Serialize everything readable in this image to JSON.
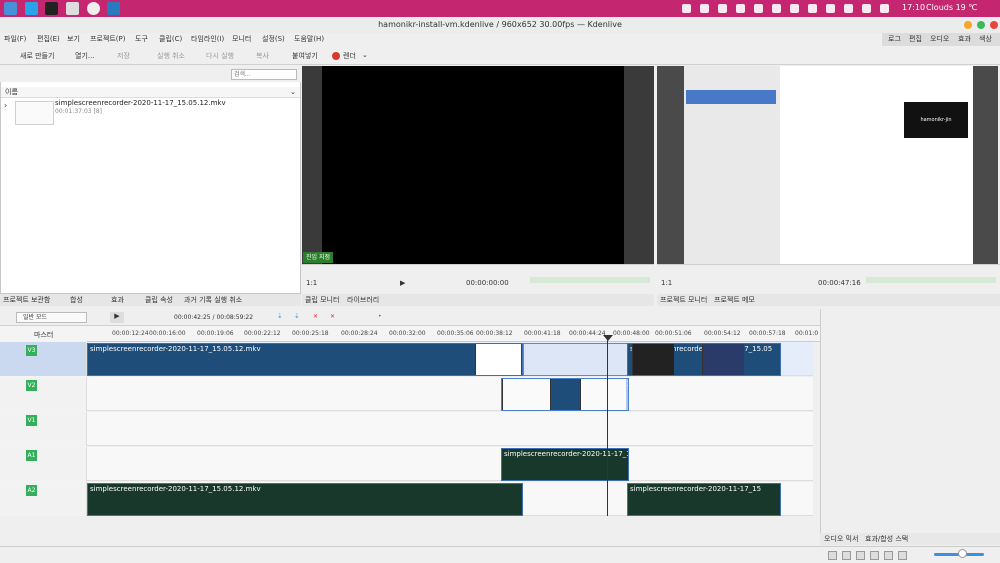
{
  "window": {
    "title": "hamonikr-install-vm.kdenlive / 960x652 30.00fps — Kdenlive"
  },
  "system": {
    "time": "17:10",
    "weather": "Clouds 19 ℃"
  },
  "menu": [
    "파일(F)",
    "편집(E)",
    "보기",
    "프로젝트(P)",
    "도구",
    "클립(C)",
    "타임라인(I)",
    "모니터",
    "설정(S)",
    "도움말(H)"
  ],
  "layouts": [
    "로그",
    "편집",
    "오디오",
    "효과",
    "색상"
  ],
  "toolbar": {
    "new": "새로 만들기",
    "open": "열기...",
    "save": "저장",
    "undo": "실행 취소",
    "redo": "다시 실행",
    "copy": "복사",
    "paste": "붙여넣기",
    "render": "렌더"
  },
  "bin": {
    "search_placeholder": "검색...",
    "col_name": "이름",
    "clip_name": "simplescreenrecorder-2020-11-17_15.05.12.mkv",
    "clip_duration": "00:01:37:03 [8]"
  },
  "clip_monitor": {
    "zone_label": "진입 지점",
    "zoom": "1:1",
    "timecode": "00:00:00:00"
  },
  "project_monitor": {
    "zoom": "1:1",
    "timecode": "00:00:47:16",
    "vm_name": "hamonikr-jin"
  },
  "left_tabs": [
    "프로젝트 보관함",
    "합성",
    "효과",
    "클립 속성",
    "과거 기록 실행 취소"
  ],
  "mid_tabs": [
    "클립 모니터",
    "라이브러리"
  ],
  "right_tabs": [
    "프로젝트 모니터",
    "프로젝트 메모"
  ],
  "timeline": {
    "mode": "일반 모드",
    "position": "00:00:42:25 / 00:08:59:22",
    "master": "마스터",
    "ruler": [
      "00:00:12:24",
      "00:00:16:00",
      "00:00:19:06",
      "00:00:22:12",
      "00:00:25:18",
      "00:00:28:24",
      "00:00:32:00",
      "00:00:35:06",
      "00:00:38:12",
      "00:00:41:18",
      "00:00:44:24",
      "00:00:48:00",
      "00:00:51:06",
      "00:00:54:12",
      "00:00:57:18",
      "00:01:0"
    ],
    "tracks": [
      "V3",
      "V2",
      "V1",
      "A1",
      "A2"
    ],
    "clip_label": "simplescreenrecorder-2020-11-17_15.05.12.mkv",
    "clip_label_short": "simplescreenrecorder-2020-11-17_15.05",
    "clip_label_trunc": "simplescreenrecorder-2020-11-17_15"
  },
  "bottom_tabs": [
    "오디오 믹서",
    "효과/합성 스택"
  ],
  "colors": {
    "sysbar": "#c4276f",
    "track_label": "#35b05a",
    "video_clip": "#1e4d7a",
    "audio_clip": "#17382a"
  }
}
